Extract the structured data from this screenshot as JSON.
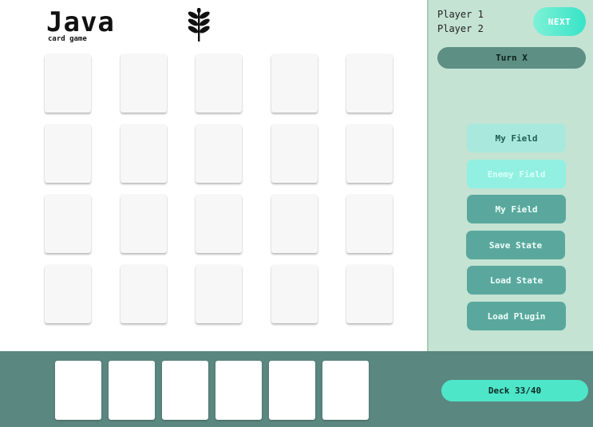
{
  "app": {
    "title": "Java",
    "subtitle": "card game",
    "logo_icon": "wheat-icon"
  },
  "board": {
    "rows": 4,
    "cols": 5
  },
  "side_panel": {
    "players": [
      "Player 1",
      "Player 2"
    ],
    "next_label": "NEXT",
    "turn_label": "Turn X",
    "buttons": [
      {
        "label": "My Field",
        "style": "light"
      },
      {
        "label": "Enemy Field",
        "style": "faint"
      },
      {
        "label": "My Field",
        "style": "dark"
      },
      {
        "label": "Save State",
        "style": "dark"
      },
      {
        "label": "Load State",
        "style": "dark"
      },
      {
        "label": "Load Plugin",
        "style": "dark"
      }
    ]
  },
  "hand": {
    "card_count": 6,
    "deck_label": "Deck 33/40"
  },
  "colors": {
    "side_bg": "#c4e3d3",
    "hand_bg": "#5a877f",
    "accent": "#37e3c8"
  }
}
